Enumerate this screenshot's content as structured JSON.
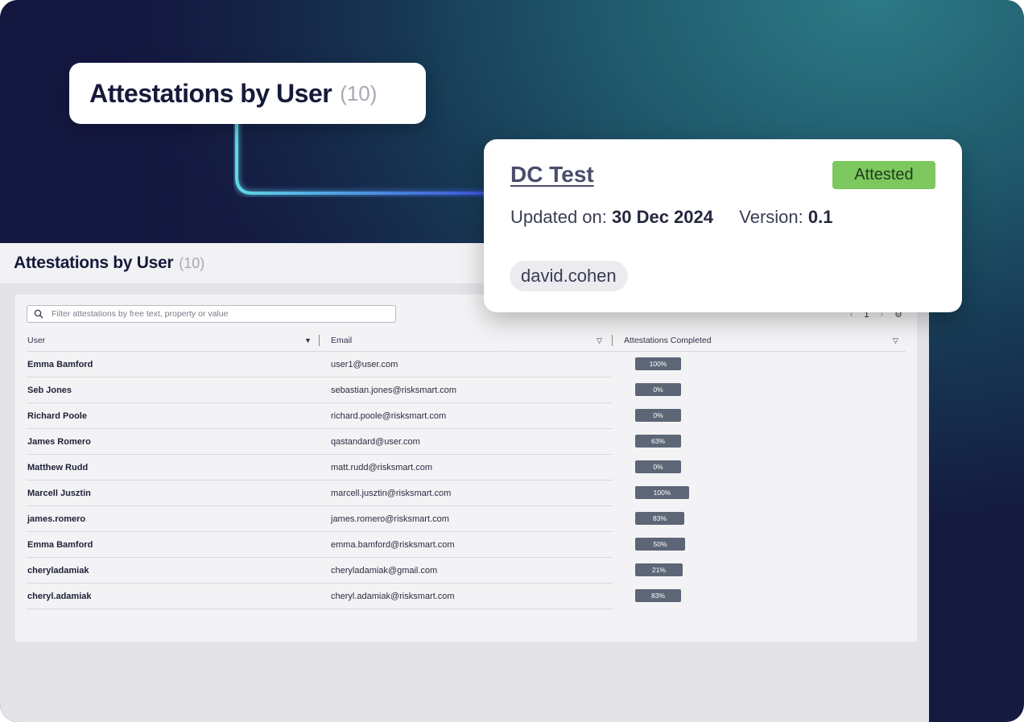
{
  "overlay_title": {
    "title": "Attestations by User",
    "count": "(10)"
  },
  "page": {
    "title": "Attestations by User",
    "count": "(10)"
  },
  "search": {
    "placeholder": "Filter attestations by free text, property or value"
  },
  "pager": {
    "page": "1"
  },
  "columns": {
    "user": "User",
    "email": "Email",
    "completed": "Attestations Completed"
  },
  "rows": [
    {
      "user": "Emma Bamford",
      "email": "user1@user.com",
      "completed": "100%"
    },
    {
      "user": "Seb Jones",
      "email": "sebastian.jones@risksmart.com",
      "completed": "0%"
    },
    {
      "user": "Richard Poole",
      "email": "richard.poole@risksmart.com",
      "completed": "0%"
    },
    {
      "user": "James Romero",
      "email": "qastandard@user.com",
      "completed": "63%"
    },
    {
      "user": "Matthew Rudd",
      "email": "matt.rudd@risksmart.com",
      "completed": "0%"
    },
    {
      "user": "Marcell Jusztin",
      "email": "marcell.jusztin@risksmart.com",
      "completed": "100%"
    },
    {
      "user": "james.romero",
      "email": "james.romero@risksmart.com",
      "completed": "83%"
    },
    {
      "user": "Emma Bamford",
      "email": "emma.bamford@risksmart.com",
      "completed": "50%"
    },
    {
      "user": "cheryladamiak",
      "email": "cheryladamiak@gmail.com",
      "completed": "21%"
    },
    {
      "user": "cheryl.adamiak",
      "email": "cheryl.adamiak@risksmart.com",
      "completed": "83%"
    }
  ],
  "popup": {
    "name": "DC Test",
    "status": "Attested",
    "updated_label": "Updated on:",
    "updated_value": "30 Dec 2024",
    "version_label": "Version:",
    "version_value": "0.1",
    "user": "david.cohen"
  },
  "colors": {
    "attested": "#7cc85e",
    "pct_badge": "#5c6676",
    "title_text": "#161a3a"
  }
}
